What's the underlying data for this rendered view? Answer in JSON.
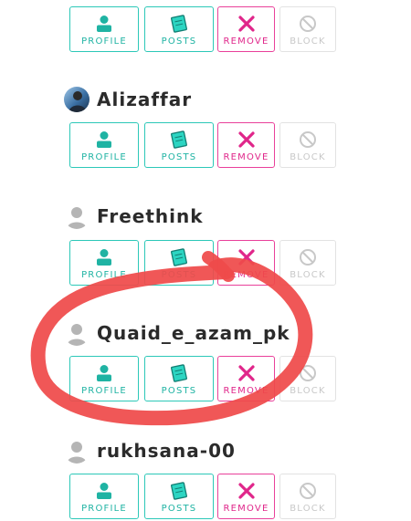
{
  "buttons": {
    "profile_label": "PROFILE",
    "posts_label": "POSTS",
    "remove_label": "REMOVE",
    "block_label": "BLOCK"
  },
  "users": [
    {
      "name": "",
      "avatar": "none"
    },
    {
      "name": "Alizaffar",
      "avatar": "photo"
    },
    {
      "name": "Freethink",
      "avatar": "default"
    },
    {
      "name": "Quaid_e_azam_pk",
      "avatar": "default"
    },
    {
      "name": "rukhsana-00",
      "avatar": "default"
    }
  ],
  "annotation": {
    "type": "hand-drawn circle",
    "color": "#ef4a4a",
    "target": "Quaid_e_azam_pk"
  },
  "colors": {
    "teal": "#1fb3a3",
    "pink": "#e0268a",
    "disabled": "#c8c8c8",
    "annotation": "#ef4a4a"
  }
}
